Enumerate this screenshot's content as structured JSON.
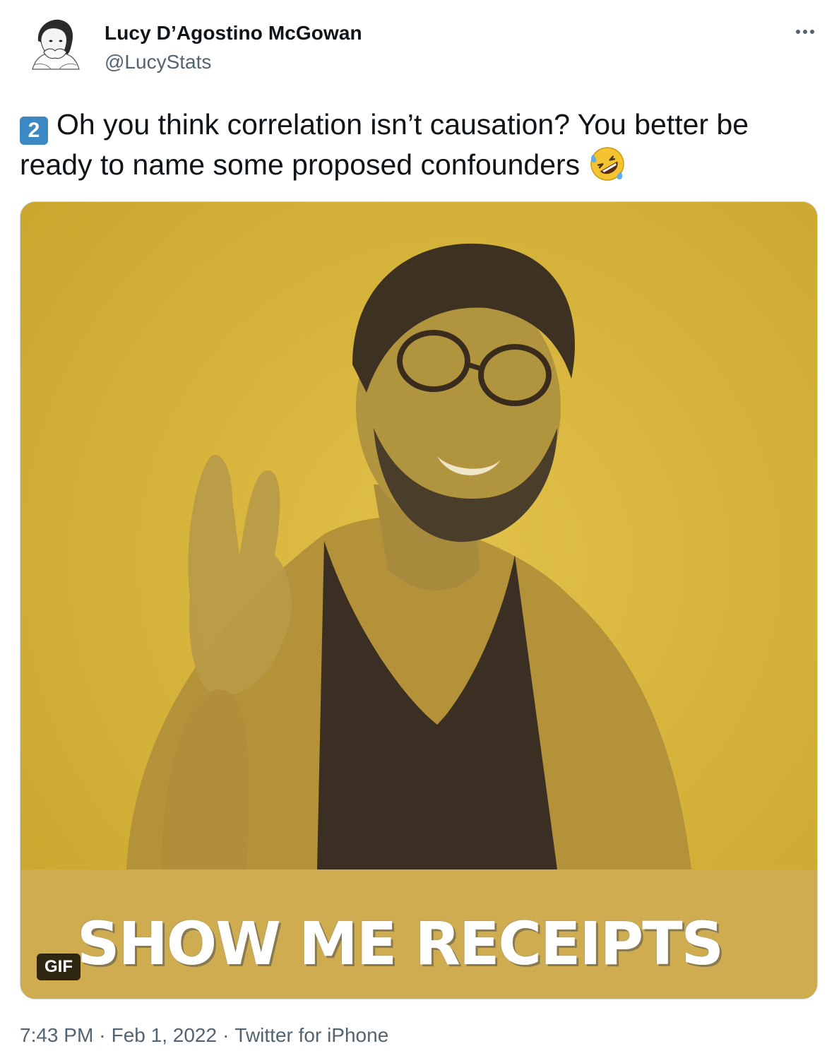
{
  "author": {
    "display_name": "Lucy D’Agostino McGowan",
    "handle": "@LucyStats",
    "avatar_icon": "sketch-portrait-avatar"
  },
  "more_icon": "more-dots-icon",
  "tweet": {
    "number_emoji": "2",
    "text": "Oh you think correlation isn’t causation? You better be ready to name some proposed confounders",
    "trailing_emoji": "rolling-on-floor-laughing-emoji"
  },
  "media": {
    "type": "gif",
    "badge": "GIF",
    "caption": "SHOW ME RECEIPTS",
    "colors": {
      "background": "#d9b43a",
      "band": "#cfac50"
    }
  },
  "meta": {
    "time": "7:43 PM",
    "separator": "·",
    "date": "Feb 1, 2022",
    "source": "Twitter for iPhone"
  },
  "colors": {
    "text": "#0f1419",
    "secondary": "#536471",
    "keycap": "#3b88c3"
  }
}
